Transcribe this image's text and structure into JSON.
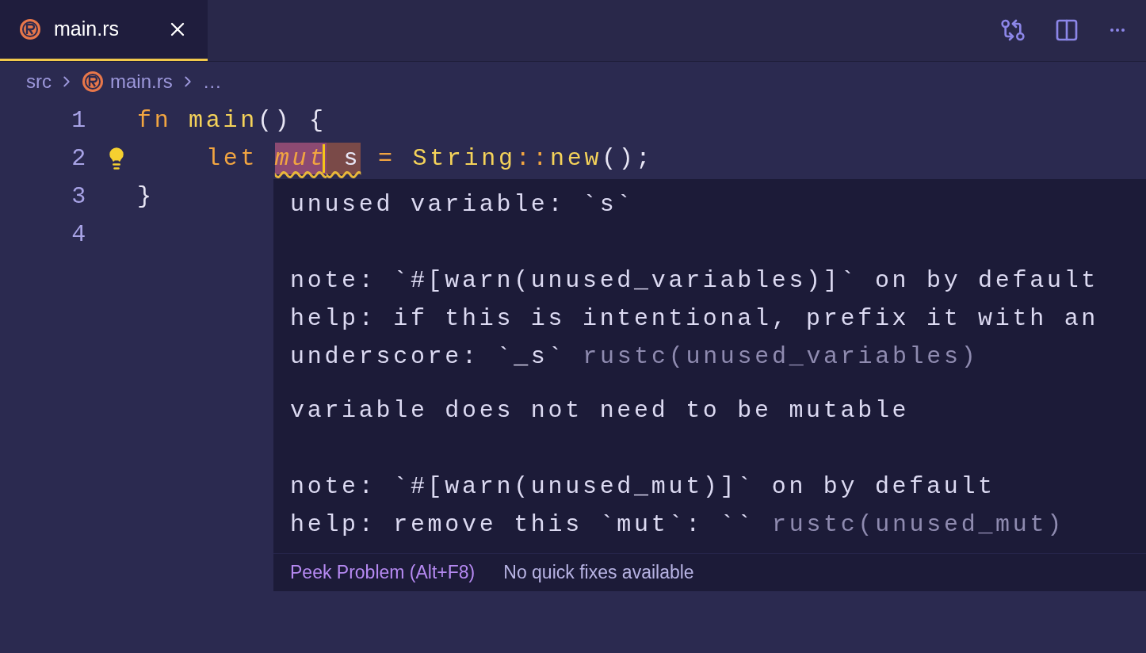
{
  "tabs": [
    {
      "label": "main.rs",
      "selected": true
    }
  ],
  "breadcrumb": [
    {
      "label": "src",
      "kind": "folder"
    },
    {
      "label": "main.rs",
      "kind": "file"
    },
    {
      "label": "…",
      "kind": "more"
    }
  ],
  "code_lines": [
    {
      "number": "1",
      "lightbulb": false,
      "tokens": [
        {
          "text": "fn ",
          "kind": "keyword"
        },
        {
          "text": "main",
          "kind": "function"
        },
        {
          "text": "() {",
          "kind": "plain"
        }
      ],
      "children": [
        {
          "number": "2",
          "lightbulb": true,
          "tokens": [
            {
              "text": "let ",
              "kind": "keyword"
            },
            {
              "text": "mut",
              "kind": "keyword_italic",
              "color": "#8c4a72",
              "cursor_after": true
            },
            {
              "text": " s",
              "kind": "plain",
              "color": "#7a4a48"
            },
            {
              "text": " = ",
              "kind": "keyword"
            },
            {
              "text": "String",
              "kind": "function"
            },
            {
              "text": "::",
              "kind": "keyword"
            },
            {
              "text": "new",
              "kind": "function"
            },
            {
              "text": "();",
              "kind": "plain"
            }
          ]
        }
      ]
    },
    {
      "number": "3",
      "lightbulb": false,
      "tokens": [
        {
          "text": "}",
          "kind": "plain"
        }
      ]
    },
    {
      "number": "4",
      "lightbulb": false
    }
  ],
  "hover": {
    "messages": [
      {
        "headline": "unused variable: `s`",
        "details": [
          "note: `#[warn(unused_variables)]` on by default",
          "help: if this is intentional, prefix it with an",
          "underscore: `_s`"
        ],
        "source": "rustc(unused_variables)"
      },
      {
        "headline": "variable does not need to be mutable",
        "details": [
          "note: `#[warn(unused_mut)]` on by default",
          "help: remove this `mut`: ``"
        ],
        "source": "rustc(unused_mut)"
      }
    ],
    "actions": [
      {
        "label": "Peek Problem (Alt+F8)",
        "kind": "link"
      },
      {
        "label": "No quick fixes available",
        "kind": "status"
      }
    ]
  }
}
